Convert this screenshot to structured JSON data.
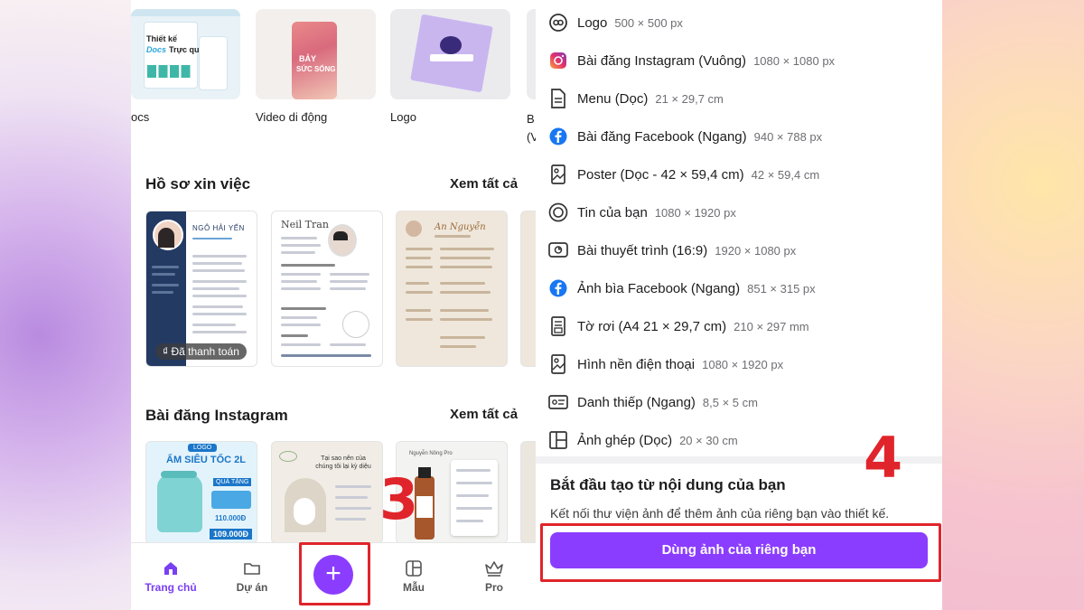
{
  "top_row": {
    "captions": [
      "ocs",
      "Video di động",
      "Logo",
      "B\n(V"
    ],
    "docs_thumb": {
      "line1": "Thiết kế",
      "line2": "Docs",
      "line3": "Trực quan"
    },
    "video_thumb": {
      "line1": "BẢY",
      "line2": "SỨC SỐNG"
    }
  },
  "resume_section": {
    "title": "Hồ sơ xin việc",
    "see_all": "Xem tất cả",
    "cards": [
      {
        "name": "NGÔ HẢI YẾN",
        "paid_badge": "₫ Đã thanh toán"
      },
      {
        "name": "Neil Tran"
      },
      {
        "name": "An Nguyễn"
      }
    ]
  },
  "instagram_section": {
    "title": "Bài đăng Instagram",
    "see_all": "Xem tất cả",
    "posts": [
      {
        "logo": "LOGO",
        "headline": "ẤM SIÊU TỐC 2L",
        "tag": "QUÀ TẶNG",
        "price_old": "110.000Đ",
        "price_new": "109.000Đ"
      },
      {
        "headline": "Tại sao nên của chúng tôi lại kỳ diệu"
      },
      {
        "brand": "Nguyễn Nông Pro"
      },
      {}
    ]
  },
  "bottom_nav": {
    "items": [
      {
        "label": "Trang chủ",
        "icon": "home-icon",
        "active": true
      },
      {
        "label": "Dự án",
        "icon": "folder-icon"
      },
      {
        "label": "+",
        "icon": "plus-icon"
      },
      {
        "label": "Mẫu",
        "icon": "template-icon"
      },
      {
        "label": "Pro",
        "icon": "crown-icon"
      }
    ]
  },
  "annotations": {
    "step3": "3",
    "step4": "4"
  },
  "sheet": {
    "design_types": [
      {
        "icon": "logo-icon",
        "name": "Logo",
        "dim": "500 × 500 px"
      },
      {
        "icon": "instagram-icon",
        "name": "Bài đăng Instagram (Vuông)",
        "dim": "1080 × 1080 px"
      },
      {
        "icon": "document-icon",
        "name": "Menu (Dọc)",
        "dim": "21 × 29,7 cm"
      },
      {
        "icon": "facebook-icon",
        "name": "Bài đăng Facebook (Ngang)",
        "dim": "940 × 788 px"
      },
      {
        "icon": "poster-icon",
        "name": "Poster (Dọc - 42 × 59,4 cm)",
        "dim": "42 × 59,4 cm"
      },
      {
        "icon": "story-icon",
        "name": "Tin của bạn",
        "dim": "1080 × 1920 px"
      },
      {
        "icon": "presentation-icon",
        "name": "Bài thuyết trình (16:9)",
        "dim": "1920 × 1080 px"
      },
      {
        "icon": "facebook-icon",
        "name": "Ảnh bìa Facebook (Ngang)",
        "dim": "851 × 315 px"
      },
      {
        "icon": "flyer-icon",
        "name": "Tờ rơi (A4 21 × 29,7 cm)",
        "dim": "210 × 297 mm"
      },
      {
        "icon": "wallpaper-icon",
        "name": "Hình nền điện thoại",
        "dim": "1080 × 1920 px"
      },
      {
        "icon": "business-card-icon",
        "name": "Danh thiếp (Ngang)",
        "dim": "8,5 × 5 cm"
      },
      {
        "icon": "collage-icon",
        "name": "Ảnh ghép (Dọc)",
        "dim": "20 × 30 cm"
      }
    ],
    "cta": {
      "title": "Bắt đầu tạo từ nội dung của bạn",
      "description": "Kết nối thư viện ảnh để thêm ảnh của riêng bạn vào thiết kế.",
      "button": "Dùng ảnh của riêng bạn"
    }
  },
  "colors": {
    "accent": "#8B3DFF",
    "annotation_red": "#E0242B"
  }
}
